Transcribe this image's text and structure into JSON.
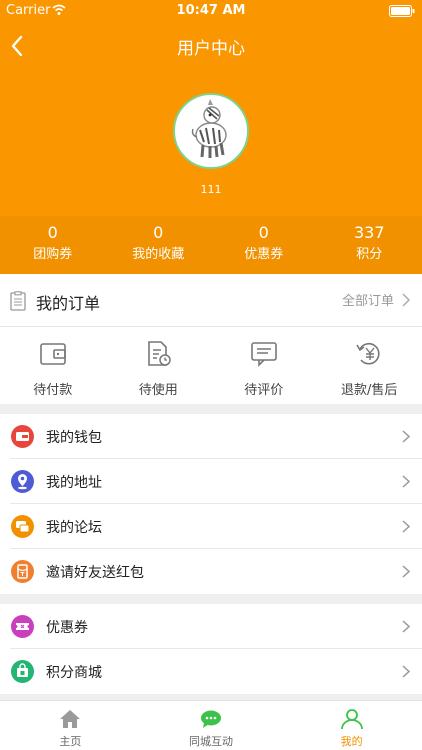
{
  "status_bar": {
    "carrier": "Carrier",
    "time": "10:47 AM"
  },
  "nav": {
    "title": "用户中心"
  },
  "profile": {
    "username": "111"
  },
  "stats": [
    {
      "value": "0",
      "label": "团购券"
    },
    {
      "value": "0",
      "label": "我的收藏"
    },
    {
      "value": "0",
      "label": "优惠券"
    },
    {
      "value": "337",
      "label": "积分"
    }
  ],
  "orders": {
    "title": "我的订单",
    "all_label": "全部订单",
    "items": [
      {
        "label": "待付款",
        "icon": "wallet-icon"
      },
      {
        "label": "待使用",
        "icon": "document-clock-icon"
      },
      {
        "label": "待评价",
        "icon": "comment-icon"
      },
      {
        "label": "退款/售后",
        "icon": "yen-refund-icon"
      }
    ]
  },
  "menu_section_1": [
    {
      "label": "我的钱包",
      "icon": "wallet-icon",
      "color": "#e8463c"
    },
    {
      "label": "我的地址",
      "icon": "location-pin-icon",
      "color": "#4f5bd5"
    },
    {
      "label": "我的论坛",
      "icon": "chat-bubbles-icon",
      "color": "#f29100"
    },
    {
      "label": "邀请好友送红包",
      "icon": "red-packet-icon",
      "color": "#f08030"
    }
  ],
  "menu_section_2": [
    {
      "label": "优惠券",
      "icon": "ticket-icon",
      "color": "#c93fbd"
    },
    {
      "label": "积分商城",
      "icon": "store-icon",
      "color": "#22b573"
    }
  ],
  "tabbar": [
    {
      "label": "主页",
      "icon": "home-icon"
    },
    {
      "label": "同城互动",
      "icon": "chat-icon"
    },
    {
      "label": "我的",
      "icon": "user-icon",
      "active": true
    }
  ],
  "colors": {
    "brand": "#f99600",
    "stats_bg": "#f29100",
    "active_tab": "#f29100"
  }
}
